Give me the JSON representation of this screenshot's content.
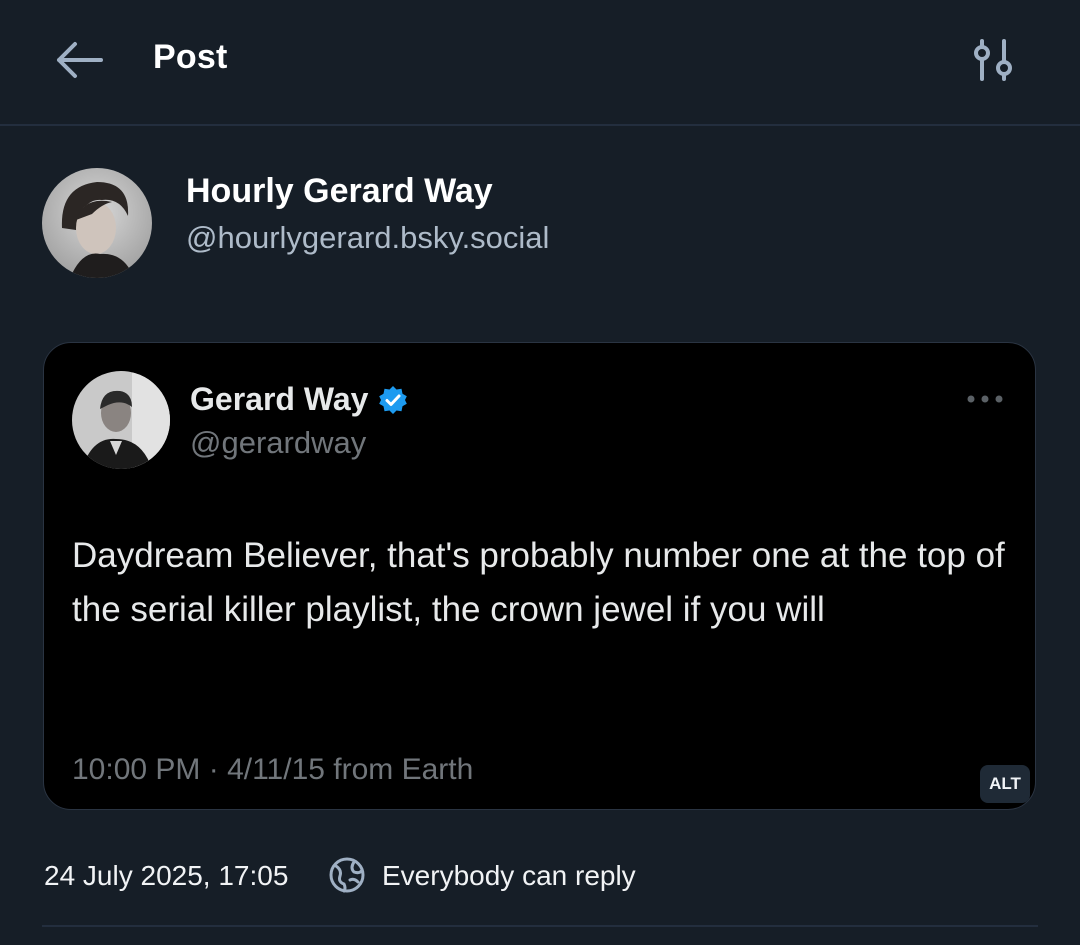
{
  "header": {
    "title": "Post",
    "back_icon": "arrow-left-icon",
    "filter_icon": "sliders-icon"
  },
  "author": {
    "display_name": "Hourly Gerard Way",
    "handle": "@hourlygerard.bsky.social"
  },
  "embed": {
    "tweet": {
      "name": "Gerard Way",
      "handle": "@gerardway",
      "text": "Daydream Believer, that's probably number one at the top of the serial killer playlist, the crown jewel if you will",
      "meta": "10:00 PM · 4/11/15 from Earth",
      "verified_color": "#1d9bf0"
    },
    "alt_badge": "ALT"
  },
  "footer": {
    "date": "24 July 2025, 17:05",
    "reply_setting": "Everybody can reply",
    "reply_icon": "globe-icon"
  },
  "colors": {
    "background": "#161e27",
    "accent_icon": "#9fb0c4",
    "divider": "#232e3e"
  }
}
